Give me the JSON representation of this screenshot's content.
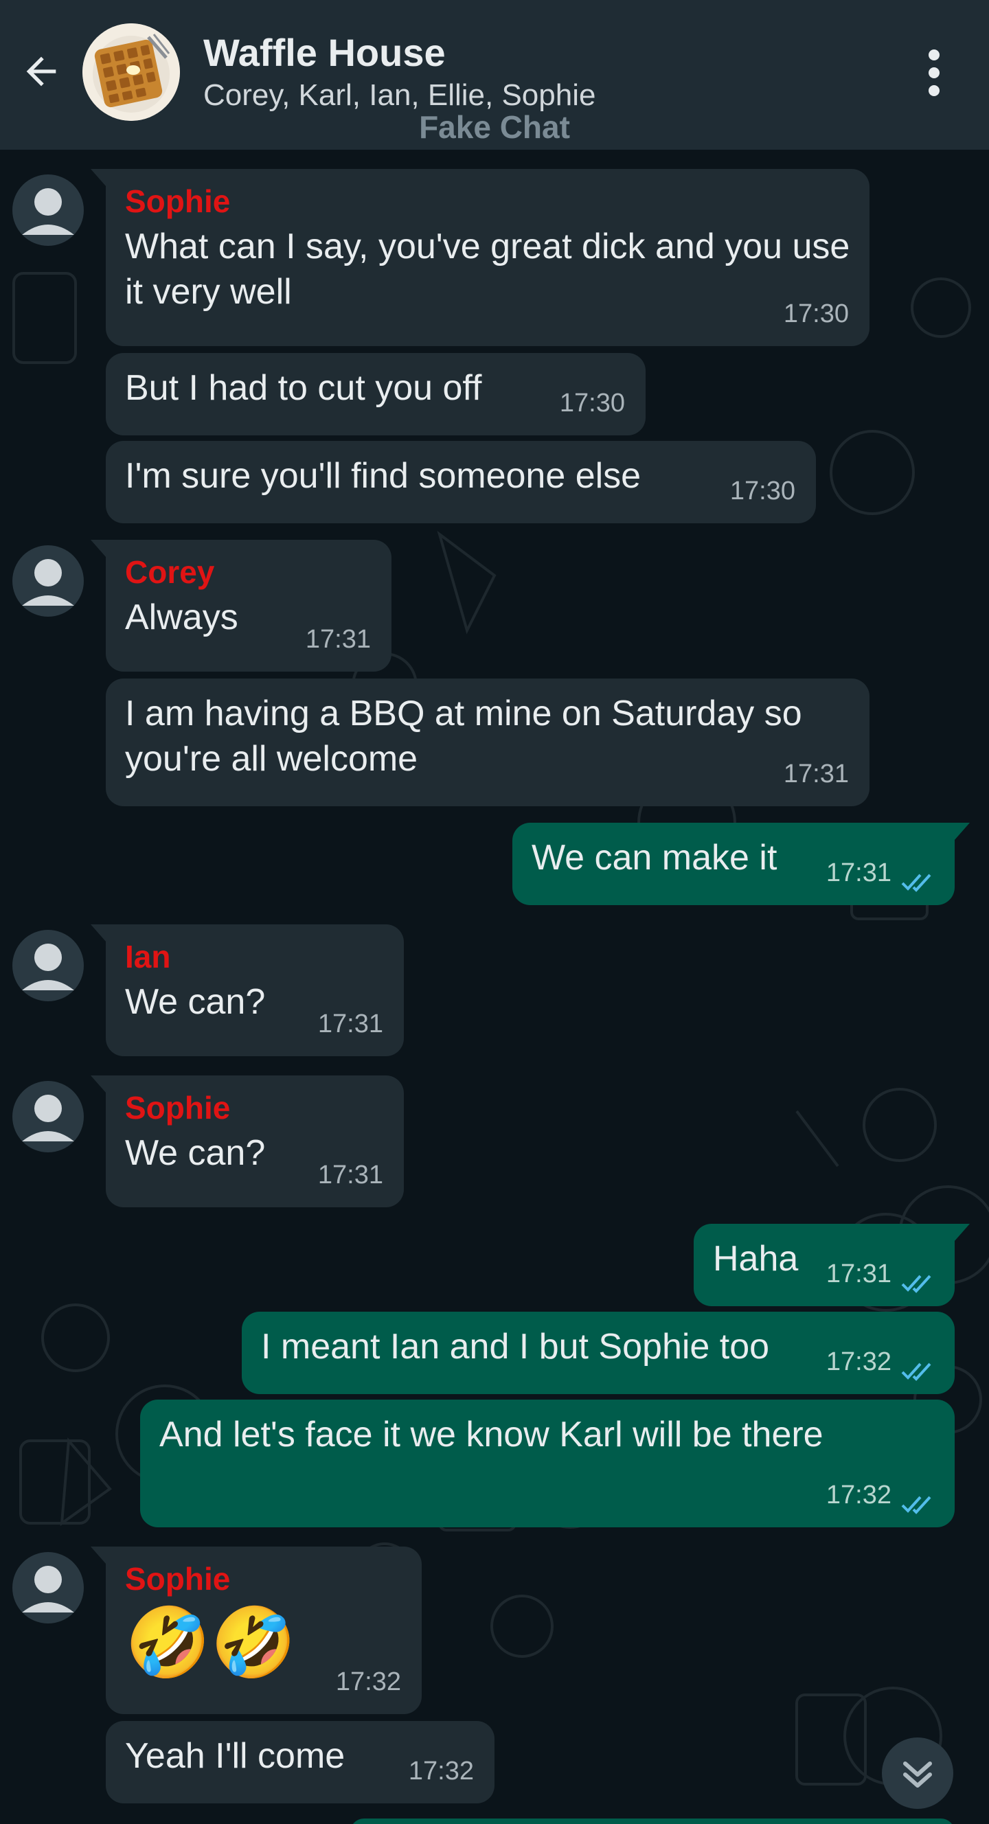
{
  "header": {
    "title": "Waffle House",
    "participants": "Corey, Karl, Ian, Ellie, Sophie",
    "watermark": "Fake Chat"
  },
  "messages": [
    {
      "sender": "Sophie",
      "text": "What can I say, you've great dick and you use it very well",
      "time": "17:30"
    },
    {
      "text": "But I had to cut you off",
      "time": "17:30"
    },
    {
      "text": "I'm sure you'll find someone else",
      "time": "17:30"
    },
    {
      "sender": "Corey",
      "text": "Always",
      "time": "17:31"
    },
    {
      "text": "I am having a BBQ at mine on Saturday so you're all welcome",
      "time": "17:31"
    },
    {
      "text": "We can make it",
      "time": "17:31",
      "status": "read"
    },
    {
      "sender": "Ian",
      "text": "We can?",
      "time": "17:31"
    },
    {
      "sender": "Sophie",
      "text": "We can?",
      "time": "17:31"
    },
    {
      "text": "Haha",
      "time": "17:31",
      "status": "read"
    },
    {
      "text": "I meant Ian and I but Sophie too",
      "time": "17:32",
      "status": "read"
    },
    {
      "text": "And let's face it we know Karl will be there",
      "time": "17:32",
      "status": "read"
    },
    {
      "sender": "Sophie",
      "text": "🤣🤣",
      "time": "17:32"
    },
    {
      "text": "Yeah I'll come",
      "time": "17:32"
    }
  ],
  "icons": {
    "back": "arrow-back-icon",
    "menu": "more-vert-icon",
    "scroll": "double-chevron-down-icon",
    "read": "double-check-icon"
  },
  "colors": {
    "header_bg": "#1f2c34",
    "chat_bg": "#0b141a",
    "incoming_bubble": "#202c33",
    "outgoing_bubble": "#005c4b",
    "sender_name": "#e01414",
    "read_tick": "#53bdeb"
  }
}
